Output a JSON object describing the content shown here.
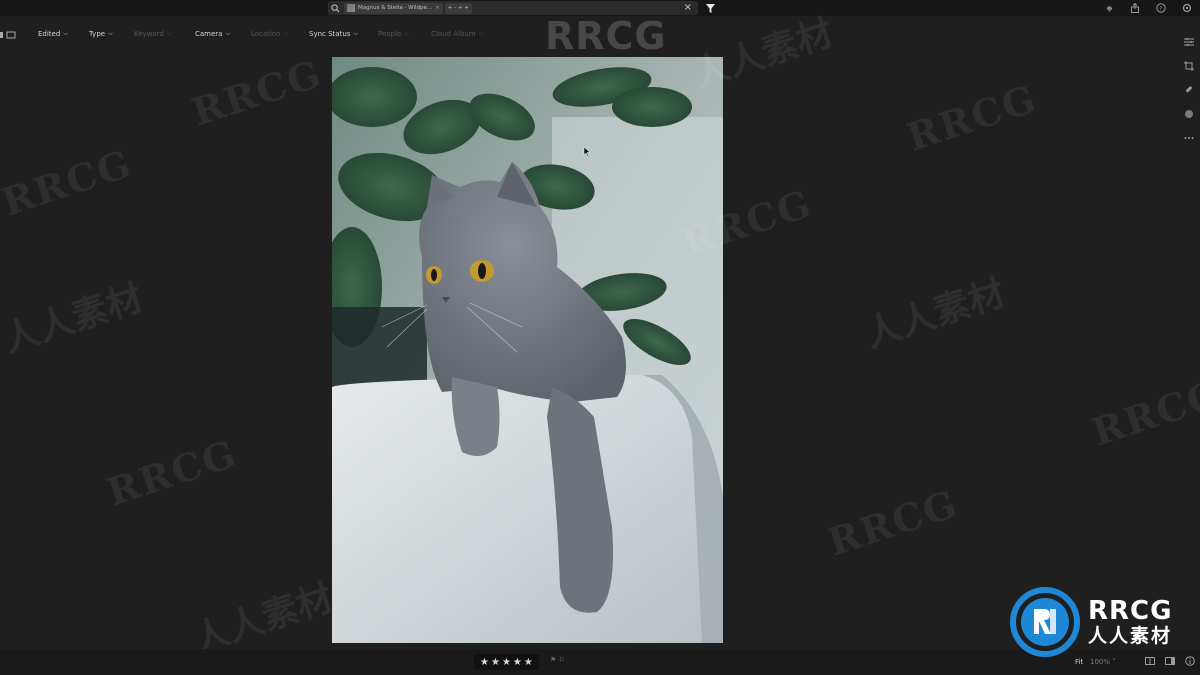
{
  "search": {
    "chip_label": "Magnus & Stella - Wildpe...",
    "chip_close": "×",
    "second_chip": "+ - + +",
    "clear_label": "×"
  },
  "filters": [
    {
      "label": "Edited",
      "state": "on"
    },
    {
      "label": "Type",
      "state": "on"
    },
    {
      "label": "Keyword",
      "state": "off"
    },
    {
      "label": "Camera",
      "state": "on"
    },
    {
      "label": "Location",
      "state": "off"
    },
    {
      "label": "Sync Status",
      "state": "on"
    },
    {
      "label": "People",
      "state": "off"
    },
    {
      "label": "Cloud Album",
      "state": "off"
    }
  ],
  "icons": {
    "search": "search-icon",
    "filter": "filter-funnel-icon",
    "top_right": [
      "cloud-sync-icon",
      "share-icon",
      "help-icon",
      "settings-icon"
    ],
    "right_tools": [
      "edit-sliders-icon",
      "crop-icon",
      "healing-brush-icon",
      "masking-icon",
      "more-icon"
    ],
    "bottom_right": [
      "compare-icon",
      "grid-view-icon",
      "info-icon"
    ]
  },
  "bottombar": {
    "stars": [
      "★",
      "★",
      "★",
      "★",
      "★"
    ],
    "flag_label": "⚑ ⚐",
    "fit_label": "Fit",
    "zoom_label": "100% ˅"
  },
  "watermark": {
    "text": "RRCG",
    "cjk_text": "人人素材"
  },
  "logo": {
    "line1": "RRCG",
    "line2": "人人素材",
    "badge_color": "#1e88d6"
  },
  "colors": {
    "background": "#1f1f1f",
    "toolbar": "#161616"
  }
}
